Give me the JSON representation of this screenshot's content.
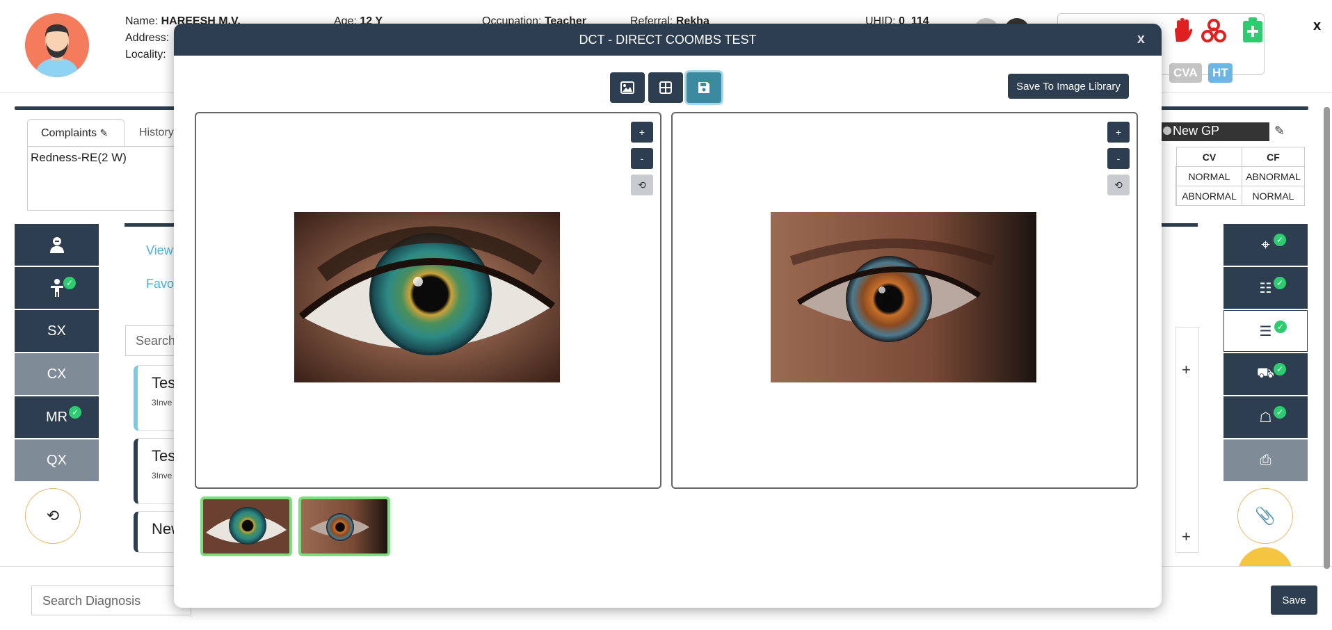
{
  "patient": {
    "name_label": "Name:",
    "name_value": "HAREESH M.V.",
    "age_label": "Age:",
    "age_value": "12 Y",
    "occupation_label": "Occupation:",
    "occupation_value": "Teacher",
    "referral_label": "Referral:",
    "referral_value": "Rekha",
    "uhid_label": "UHID:",
    "uhid_value": "0_114",
    "address_label": "Address:",
    "locality_label": "Locality:"
  },
  "alerts": {
    "tag1": "CVA",
    "tag2": "HT"
  },
  "header_close": "x",
  "complaints": {
    "tab_label": "Complaints",
    "history_tab": "History",
    "entry": "Redness-RE(2 W)"
  },
  "left_nav": [
    {
      "label": "",
      "icon": "doctor-icon"
    },
    {
      "label": "",
      "icon": "patient-icon"
    },
    {
      "label": "SX"
    },
    {
      "label": "CX"
    },
    {
      "label": "MR"
    },
    {
      "label": "QX"
    }
  ],
  "middle": {
    "view_link": "View",
    "fav_link": "Favo",
    "search_placeholder": "Search",
    "cards": [
      {
        "title": "Tes",
        "sub": "3Inve"
      },
      {
        "title": "Tes",
        "sub": "3Inve"
      },
      {
        "title": "New",
        "sub": ""
      }
    ]
  },
  "gp": {
    "value": "New GP"
  },
  "cv_table": {
    "headers": [
      "CV",
      "CF"
    ],
    "rows": [
      [
        "NORMAL",
        "ABNORMAL"
      ],
      [
        "ABNORMAL",
        "NORMAL"
      ]
    ]
  },
  "right_panel": {
    "plus": "+"
  },
  "bottom": {
    "diagnosis_placeholder": "Search Diagnosis",
    "save_label": "Save"
  },
  "modal": {
    "title": "DCT - DIRECT COOMBS TEST",
    "close": "x",
    "save_library_label": "Save To Image Library",
    "zoom_in": "+",
    "zoom_out": "-"
  },
  "colors": {
    "primary": "#2c3e50",
    "accent": "#3b8aa0",
    "thumb_border": "#7be07b",
    "check": "#2ecc71",
    "alert_red": "#e02020"
  }
}
